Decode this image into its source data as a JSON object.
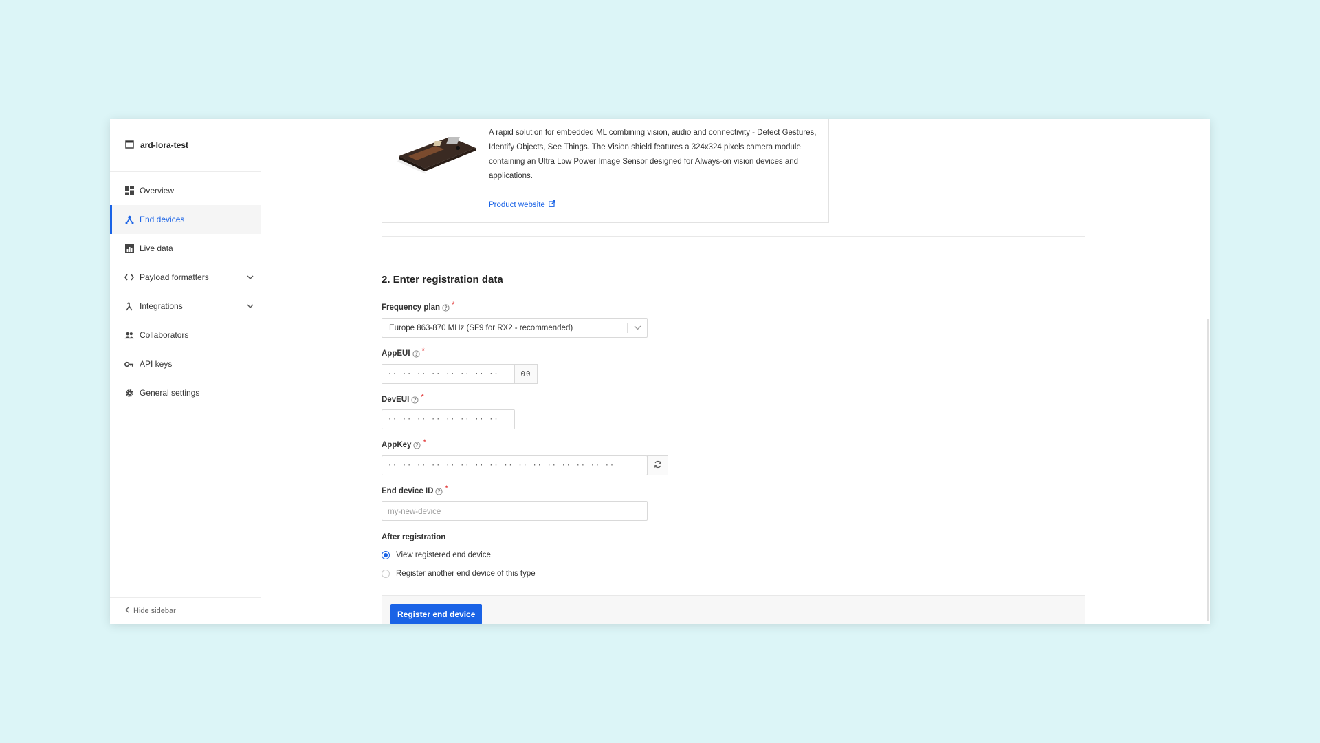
{
  "sidebar": {
    "app_name": "ard-lora-test",
    "items": [
      {
        "label": "Overview",
        "icon": "grid-icon",
        "active": false
      },
      {
        "label": "End devices",
        "icon": "devices-icon",
        "active": true
      },
      {
        "label": "Live data",
        "icon": "chart-icon",
        "active": false
      },
      {
        "label": "Payload formatters",
        "icon": "code-icon",
        "active": false,
        "expandable": true
      },
      {
        "label": "Integrations",
        "icon": "fork-icon",
        "active": false,
        "expandable": true
      },
      {
        "label": "Collaborators",
        "icon": "people-icon",
        "active": false
      },
      {
        "label": "API keys",
        "icon": "key-icon",
        "active": false
      },
      {
        "label": "General settings",
        "icon": "gear-icon",
        "active": false
      }
    ],
    "hide_label": "Hide sidebar"
  },
  "product": {
    "description": "A rapid solution for embedded ML combining vision, audio and connectivity - Detect Gestures, Identify Objects, See Things. The Vision shield features a 324x324 pixels camera module containing an Ultra Low Power Image Sensor designed for Always-on vision devices and applications.",
    "link_label": "Product website"
  },
  "form": {
    "title": "2. Enter registration data",
    "frequency_plan": {
      "label": "Frequency plan",
      "value": "Europe 863-870 MHz (SF9 for RX2 - recommended)"
    },
    "app_eui": {
      "label": "AppEUI",
      "placeholder": "·· ·· ·· ·· ·· ·· ·· ··",
      "addon": "00"
    },
    "dev_eui": {
      "label": "DevEUI",
      "placeholder": "·· ·· ·· ·· ·· ·· ·· ··"
    },
    "app_key": {
      "label": "AppKey",
      "placeholder": "·· ·· ·· ·· ·· ·· ·· ·· ·· ·· ·· ·· ·· ·· ·· ··"
    },
    "device_id": {
      "label": "End device ID",
      "placeholder": "my-new-device"
    },
    "after_registration": {
      "label": "After registration",
      "options": [
        {
          "label": "View registered end device",
          "checked": true
        },
        {
          "label": "Register another end device of this type",
          "checked": false
        }
      ]
    },
    "submit_label": "Register end device"
  },
  "colors": {
    "accent": "#1a63e6",
    "required": "#e23b3b",
    "background": "#dcf5f7"
  }
}
